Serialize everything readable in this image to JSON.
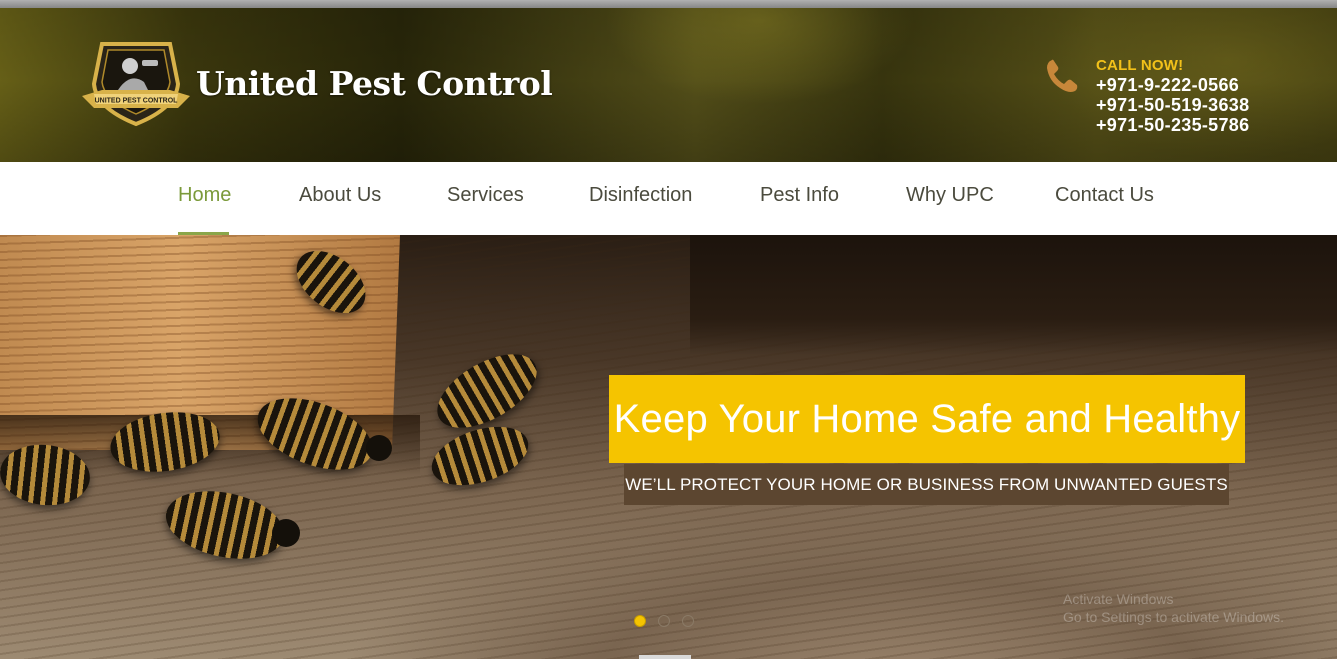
{
  "header": {
    "brand": "United Pest Control",
    "logo": {
      "icon": "united-pest-control-logo",
      "ribbon_text": "UNITED PEST CONTROL"
    },
    "contact": {
      "call_label": "CALL NOW!",
      "phones": [
        "+971-9-222-0566",
        "+971-50-519-3638",
        "+971-50-235-5786"
      ],
      "icon": "phone-icon"
    }
  },
  "nav": {
    "items": [
      {
        "label": "Home",
        "active": true
      },
      {
        "label": "About Us",
        "active": false
      },
      {
        "label": "Services",
        "active": false
      },
      {
        "label": "Disinfection",
        "active": false
      },
      {
        "label": "Pest Info",
        "active": false
      },
      {
        "label": "Why UPC",
        "active": false
      },
      {
        "label": "Contact Us",
        "active": false
      }
    ]
  },
  "hero": {
    "headline": "Keep Your Home Safe and Healthy",
    "subline": "WE’LL PROTECT YOUR HOME OR BUSINESS FROM UNWANTED GUESTS",
    "slides": {
      "count": 3,
      "active_index": 0
    },
    "watermark": [
      "Activate Windows",
      "Go to Settings to activate Windows."
    ]
  },
  "colors": {
    "accent_yellow": "#f5c400",
    "nav_active": "#7b9a3a",
    "subline_bg": "#5c4630",
    "call_label": "#f2c11a"
  }
}
